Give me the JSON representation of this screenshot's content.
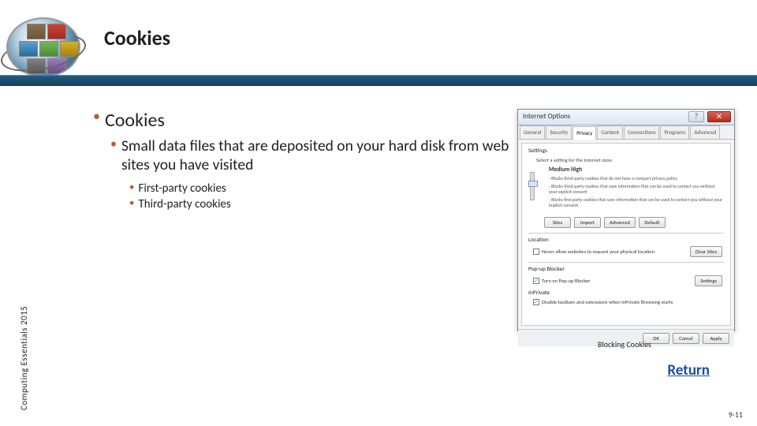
{
  "header": {
    "title": "Cookies"
  },
  "sidebar": {
    "label": "Computing Essentials 2015"
  },
  "bullets": {
    "l1": "Cookies",
    "l2": "Small data files that are deposited on your hard disk from web sites you have visited",
    "l3a": "First-party cookies",
    "l3b": "Third-party cookies"
  },
  "dialog": {
    "title": "Internet Options",
    "tabs": [
      "General",
      "Security",
      "Privacy",
      "Content",
      "Connections",
      "Programs",
      "Advanced"
    ],
    "active_tab": "Privacy",
    "group_settings": "Settings",
    "zone_prompt": "Select a setting for the Internet zone.",
    "level": "Medium High",
    "desc1": "- Blocks third-party cookies that do not have a compact privacy policy",
    "desc2": "- Blocks third-party cookies that save information that can be used to contact you without your explicit consent",
    "desc3": "- Blocks first-party cookies that save information that can be used to contact you without your implicit consent",
    "btn_sites": "Sites",
    "btn_import": "Import",
    "btn_advanced": "Advanced",
    "btn_default": "Default",
    "group_location": "Location",
    "loc_chk": "Never allow websites to request your physical location",
    "btn_clearsites": "Clear Sites",
    "group_popup": "Pop-up Blocker",
    "popup_chk": "Turn on Pop-up Blocker",
    "btn_settings": "Settings",
    "group_inprivate": "InPrivate",
    "inprivate_chk": "Disable toolbars and extensions when InPrivate Browsing starts",
    "btn_ok": "OK",
    "btn_cancel": "Cancel",
    "btn_apply": "Apply"
  },
  "caption": "Blocking Cookies",
  "return_label": "Return",
  "page_number": "9-11"
}
